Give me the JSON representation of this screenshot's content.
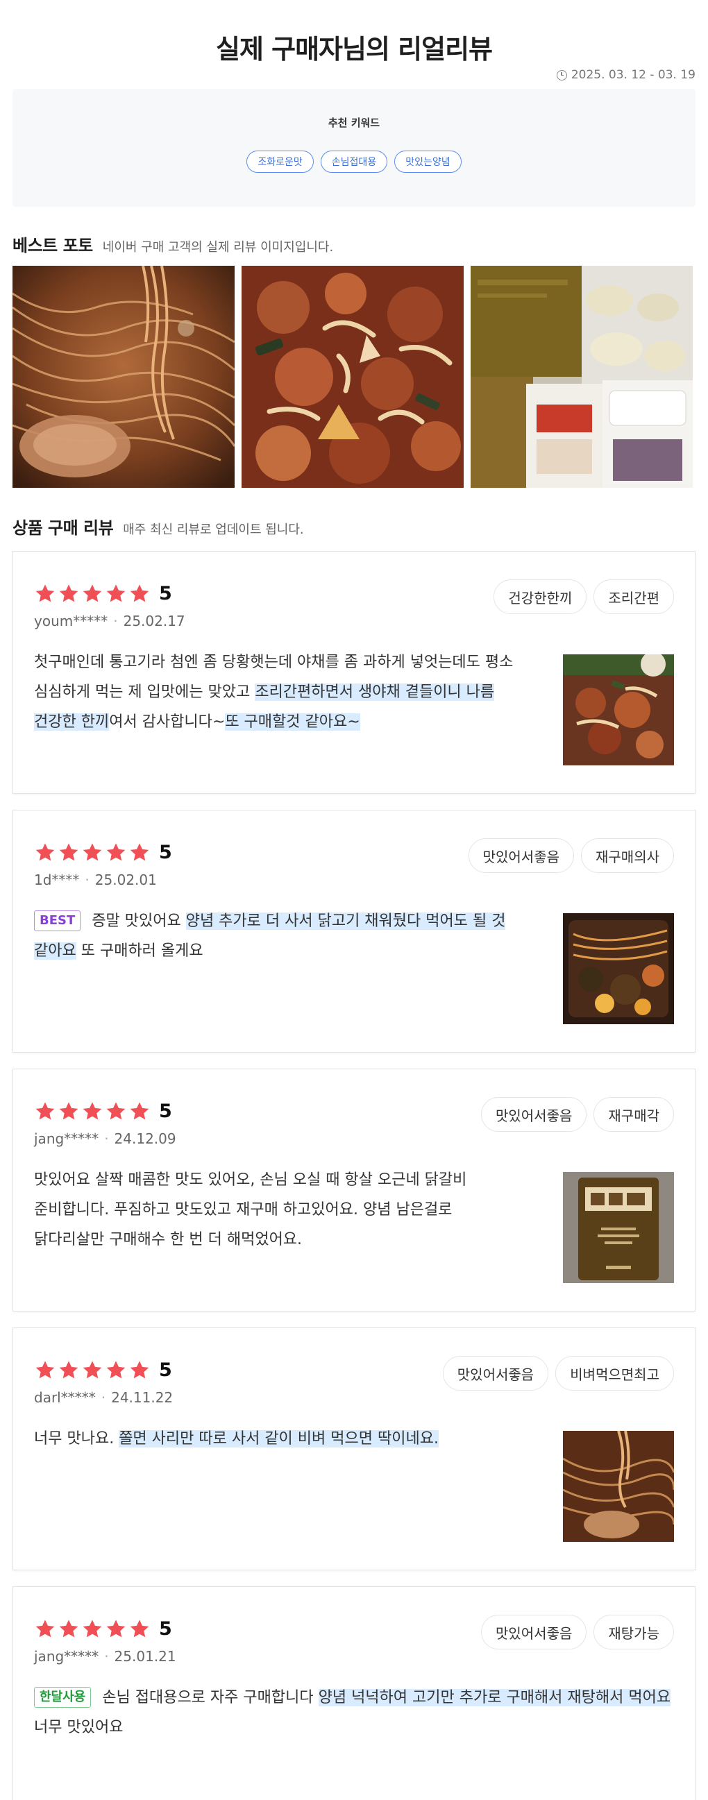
{
  "header": {
    "title": "실제 구매자님의 리얼리뷰",
    "date_range": "2025. 03. 12 - 03. 19"
  },
  "keywords": {
    "title": "추천 키워드",
    "items": [
      "조화로운맛",
      "손님접대용",
      "맛있는양념"
    ]
  },
  "best_photo": {
    "title": "베스트 포토",
    "subtitle": "네이버 구매 고객의 실제 리뷰 이미지입니다."
  },
  "reviews_section": {
    "title": "상품 구매 리뷰",
    "subtitle": "매주 최신 리뷰로 업데이트 됩니다."
  },
  "colors": {
    "star": "#ef4f55",
    "highlight": "#d9ecff",
    "chip_border": "#5b8def"
  },
  "reviews": [
    {
      "rating": "5",
      "user": "youm*****",
      "date": "25.02.17",
      "tags": [
        "건강한한끼",
        "조리간편"
      ],
      "badge": "",
      "segments": [
        {
          "t": "첫구매인데 통고기라 첨엔 좀 당황햇는데 야채를 좀 과하게 넣엇는데도 평소 심심하게 먹는 제 입맛에는 맞았고 ",
          "h": false
        },
        {
          "t": "조리간편하면서 생야채 곁들이니 나름 건강한 한끼",
          "h": true
        },
        {
          "t": "여서 감사합니다~",
          "h": false
        },
        {
          "t": "또 구매할것 같아요~",
          "h": true
        }
      ]
    },
    {
      "rating": "5",
      "user": "1d****",
      "date": "25.02.01",
      "tags": [
        "맛있어서좋음",
        "재구매의사"
      ],
      "badge": "BEST",
      "segments": [
        {
          "t": "증말 맛있어요 ",
          "h": false
        },
        {
          "t": "양념 추가로 더 사서 닭고기 채워뒀다 먹어도 될 것 같아요",
          "h": true
        },
        {
          "t": " 또 구매하러 올게요",
          "h": false
        }
      ]
    },
    {
      "rating": "5",
      "user": "jang*****",
      "date": "24.12.09",
      "tags": [
        "맛있어서좋음",
        "재구매각"
      ],
      "badge": "",
      "segments": [
        {
          "t": "맛있어요 살짝 매콤한 맛도 있어오, 손님 오실 때 항살 오근네 닭갈비 준비합니다. 푸짐하고 맛도있고 재구매 하고있어요. 양념 남은걸로 닭다리살만 구매해수 한 번 더 해먹었어요.",
          "h": false
        }
      ]
    },
    {
      "rating": "5",
      "user": "darl*****",
      "date": "24.11.22",
      "tags": [
        "맛있어서좋음",
        "비벼먹으면최고"
      ],
      "badge": "",
      "segments": [
        {
          "t": "너무 맛나요. ",
          "h": false
        },
        {
          "t": "쫄면 사리만 따로 사서 같이 비벼 먹으면 딱이네요.",
          "h": true
        }
      ]
    },
    {
      "rating": "5",
      "user": "jang*****",
      "date": "25.01.21",
      "tags": [
        "맛있어서좋음",
        "재탕가능"
      ],
      "badge": "한달사용",
      "segments": [
        {
          "t": "손님 접대용으로 자주 구매합니다 ",
          "h": false
        },
        {
          "t": "양념 넉넉하여 고기만 추가로 구매해서 재탕해서 먹어요",
          "h": true
        },
        {
          "t": " 너무 맛있어요",
          "h": false
        }
      ]
    }
  ]
}
